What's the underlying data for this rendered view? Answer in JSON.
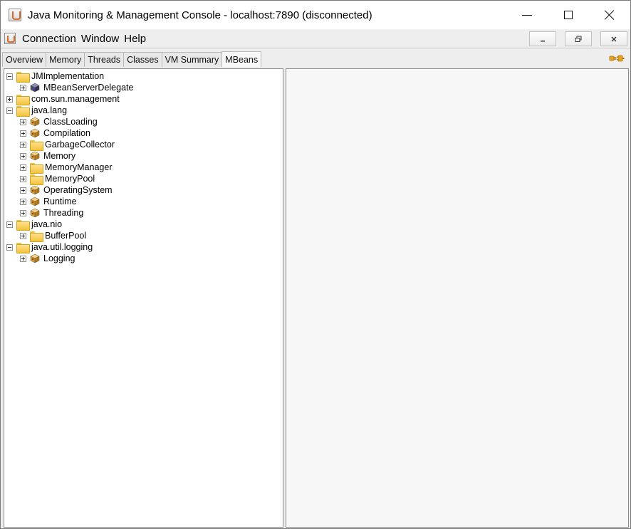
{
  "window": {
    "title": "Java Monitoring & Management Console - localhost:7890 (disconnected)"
  },
  "menubar": {
    "items": [
      "Connection",
      "Window",
      "Help"
    ]
  },
  "tabs": [
    {
      "label": "Overview"
    },
    {
      "label": "Memory"
    },
    {
      "label": "Threads"
    },
    {
      "label": "Classes"
    },
    {
      "label": "VM Summary"
    },
    {
      "label": "MBeans"
    }
  ],
  "active_tab": "MBeans",
  "tree": {
    "nodes": [
      {
        "label": "JMImplementation",
        "level": 0,
        "kind": "folder",
        "expanded": true
      },
      {
        "label": "MBeanServerDelegate",
        "level": 1,
        "kind": "bean-dark",
        "expanded": false
      },
      {
        "label": "com.sun.management",
        "level": 0,
        "kind": "folder",
        "expanded": false
      },
      {
        "label": "java.lang",
        "level": 0,
        "kind": "folder",
        "expanded": true
      },
      {
        "label": "ClassLoading",
        "level": 1,
        "kind": "bean",
        "expanded": false
      },
      {
        "label": "Compilation",
        "level": 1,
        "kind": "bean",
        "expanded": false
      },
      {
        "label": "GarbageCollector",
        "level": 1,
        "kind": "folder",
        "expanded": false
      },
      {
        "label": "Memory",
        "level": 1,
        "kind": "bean",
        "expanded": false
      },
      {
        "label": "MemoryManager",
        "level": 1,
        "kind": "folder",
        "expanded": false
      },
      {
        "label": "MemoryPool",
        "level": 1,
        "kind": "folder",
        "expanded": false
      },
      {
        "label": "OperatingSystem",
        "level": 1,
        "kind": "bean",
        "expanded": false
      },
      {
        "label": "Runtime",
        "level": 1,
        "kind": "bean",
        "expanded": false
      },
      {
        "label": "Threading",
        "level": 1,
        "kind": "bean",
        "expanded": false
      },
      {
        "label": "java.nio",
        "level": 0,
        "kind": "folder",
        "expanded": true
      },
      {
        "label": "BufferPool",
        "level": 1,
        "kind": "folder",
        "expanded": false
      },
      {
        "label": "java.util.logging",
        "level": 0,
        "kind": "folder",
        "expanded": true
      },
      {
        "label": "Logging",
        "level": 1,
        "kind": "bean",
        "expanded": false
      }
    ]
  },
  "icons": {
    "app": "java-coffee-cup-icon",
    "connection_status": "disconnected-plug-icon"
  },
  "colors": {
    "folder": "#f2c341",
    "bean": "#e0a030",
    "bean_dark": "#4a4a7a"
  }
}
